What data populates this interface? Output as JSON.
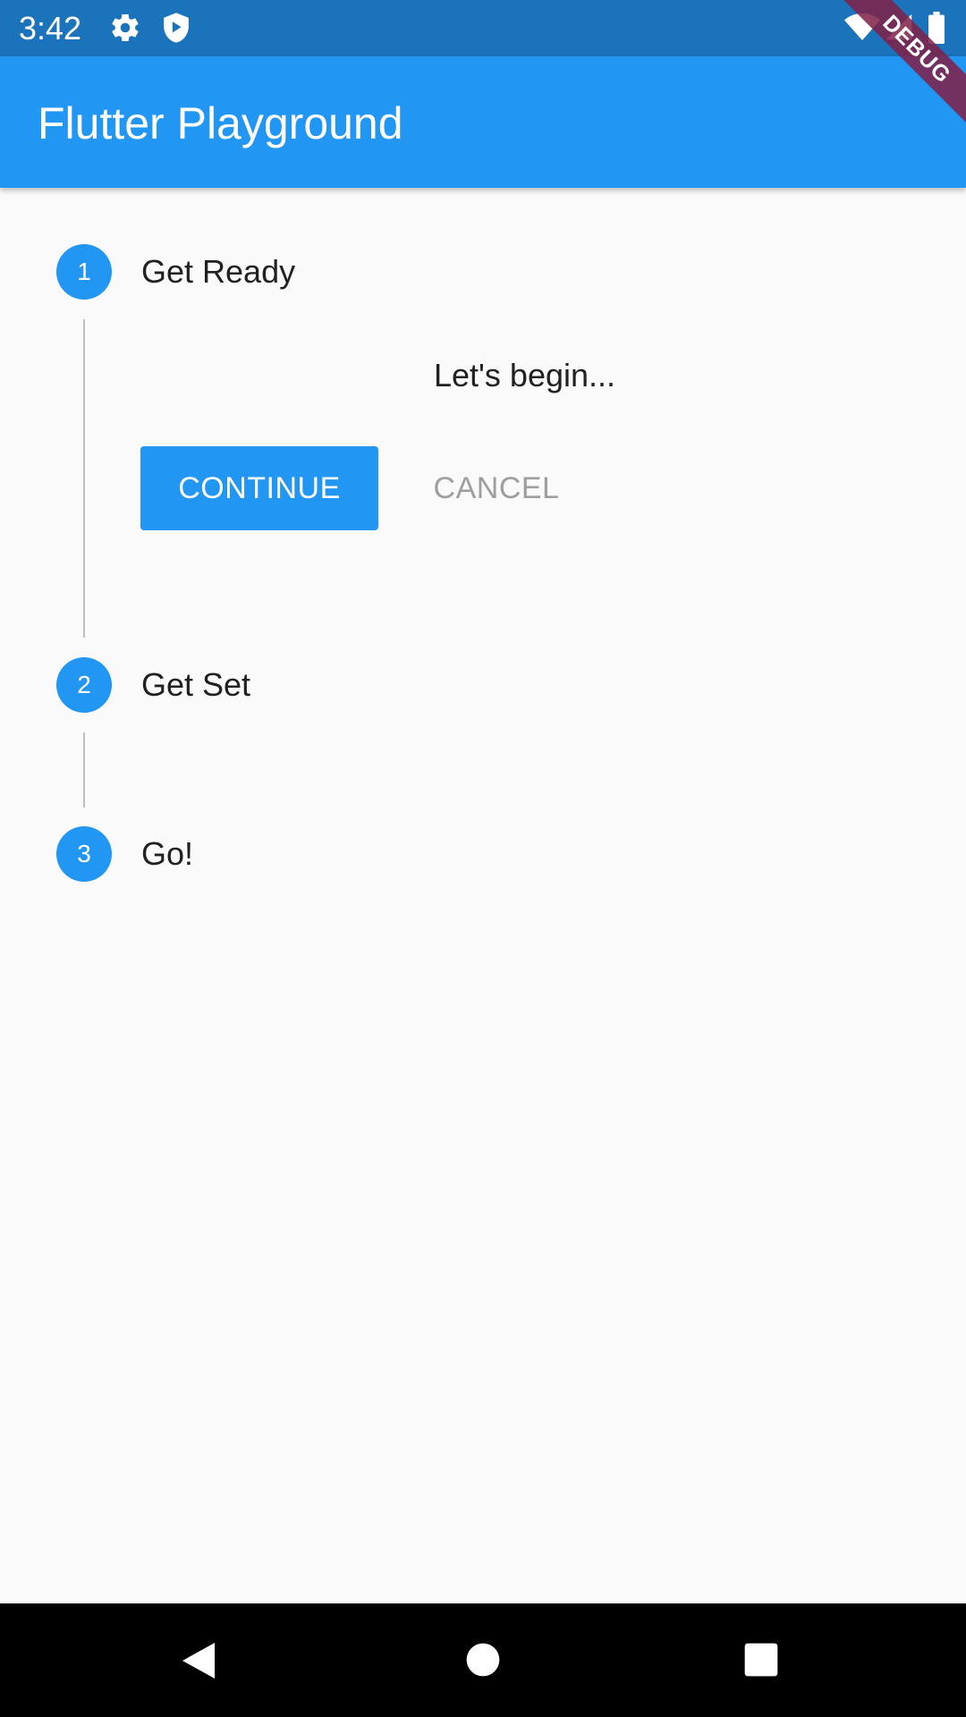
{
  "status_bar": {
    "time": "3:42",
    "left_icons": [
      "gear-icon",
      "shield-play-icon"
    ],
    "right_icons": [
      "wifi-icon",
      "cell-signal-icon",
      "battery-icon"
    ]
  },
  "debug_banner": "DEBUG",
  "app_bar": {
    "title": "Flutter Playground",
    "color": "#2196f3"
  },
  "stepper": {
    "steps": [
      {
        "number": "1",
        "title": "Get Ready",
        "active": true
      },
      {
        "number": "2",
        "title": "Get Set",
        "active": false
      },
      {
        "number": "3",
        "title": "Go!",
        "active": false
      }
    ],
    "active_content": "Let's begin...",
    "continue_label": "CONTINUE",
    "cancel_label": "CANCEL"
  },
  "nav_bar": {
    "icons": [
      "back-icon",
      "home-icon",
      "recents-icon"
    ]
  }
}
